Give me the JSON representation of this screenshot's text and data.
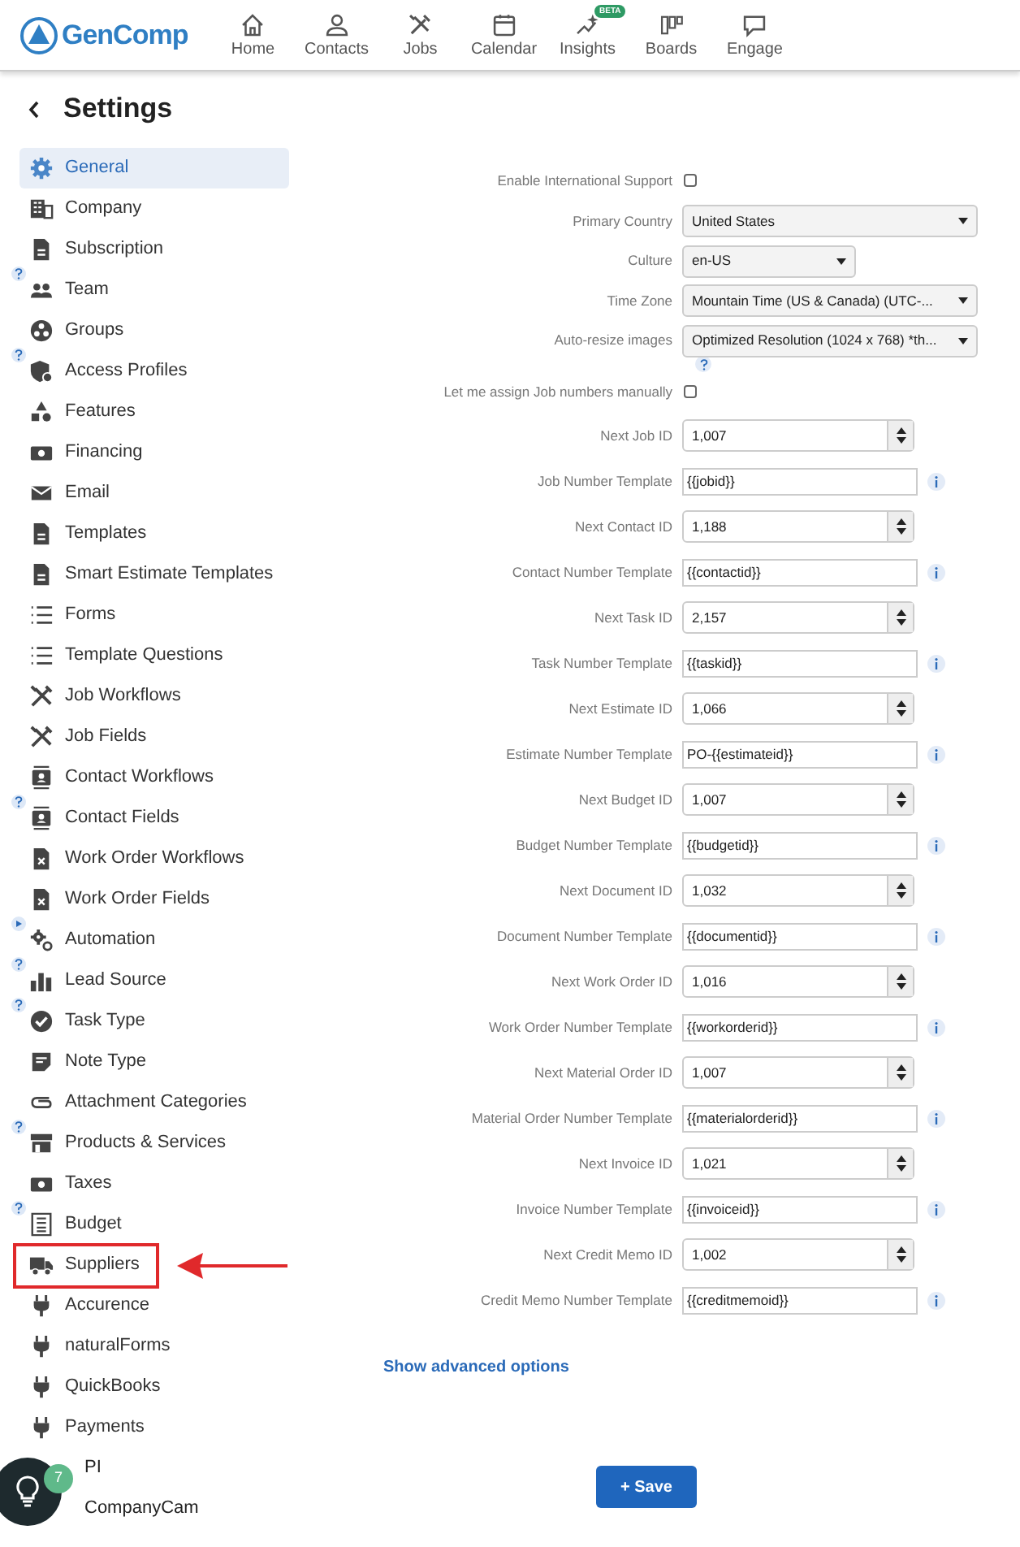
{
  "header": {
    "logo": "GenComp",
    "nav": [
      {
        "label": "Home"
      },
      {
        "label": "Contacts"
      },
      {
        "label": "Jobs"
      },
      {
        "label": "Calendar"
      },
      {
        "label": "Insights",
        "badge": "BETA"
      },
      {
        "label": "Boards"
      },
      {
        "label": "Engage"
      }
    ]
  },
  "page_title": "Settings",
  "sidebar": {
    "items": [
      {
        "label": "General",
        "selected": true,
        "help": false,
        "play": false,
        "highlighted": false
      },
      {
        "label": "Company",
        "selected": false,
        "help": false,
        "play": false,
        "highlighted": false
      },
      {
        "label": "Subscription",
        "selected": false,
        "help": false,
        "play": false,
        "highlighted": false
      },
      {
        "label": "Team",
        "selected": false,
        "help": true,
        "play": false,
        "highlighted": false
      },
      {
        "label": "Groups",
        "selected": false,
        "help": false,
        "play": false,
        "highlighted": false
      },
      {
        "label": "Access Profiles",
        "selected": false,
        "help": true,
        "play": false,
        "highlighted": false
      },
      {
        "label": "Features",
        "selected": false,
        "help": false,
        "play": false,
        "highlighted": false
      },
      {
        "label": "Financing",
        "selected": false,
        "help": false,
        "play": false,
        "highlighted": false
      },
      {
        "label": "Email",
        "selected": false,
        "help": false,
        "play": false,
        "highlighted": false
      },
      {
        "label": "Templates",
        "selected": false,
        "help": false,
        "play": false,
        "highlighted": false
      },
      {
        "label": "Smart Estimate Templates",
        "selected": false,
        "help": false,
        "play": false,
        "highlighted": false
      },
      {
        "label": "Forms",
        "selected": false,
        "help": false,
        "play": false,
        "highlighted": false
      },
      {
        "label": "Template Questions",
        "selected": false,
        "help": false,
        "play": false,
        "highlighted": false
      },
      {
        "label": "Job Workflows",
        "selected": false,
        "help": false,
        "play": false,
        "highlighted": false
      },
      {
        "label": "Job Fields",
        "selected": false,
        "help": false,
        "play": false,
        "highlighted": false
      },
      {
        "label": "Contact Workflows",
        "selected": false,
        "help": false,
        "play": false,
        "highlighted": false
      },
      {
        "label": "Contact Fields",
        "selected": false,
        "help": true,
        "play": false,
        "highlighted": false
      },
      {
        "label": "Work Order Workflows",
        "selected": false,
        "help": false,
        "play": false,
        "highlighted": false
      },
      {
        "label": "Work Order Fields",
        "selected": false,
        "help": false,
        "play": false,
        "highlighted": false
      },
      {
        "label": "Automation",
        "selected": false,
        "help": false,
        "play": true,
        "highlighted": false
      },
      {
        "label": "Lead Source",
        "selected": false,
        "help": true,
        "play": false,
        "highlighted": false
      },
      {
        "label": "Task Type",
        "selected": false,
        "help": true,
        "play": false,
        "highlighted": false
      },
      {
        "label": "Note Type",
        "selected": false,
        "help": false,
        "play": false,
        "highlighted": false
      },
      {
        "label": "Attachment Categories",
        "selected": false,
        "help": false,
        "play": false,
        "highlighted": false
      },
      {
        "label": "Products & Services",
        "selected": false,
        "help": true,
        "play": false,
        "highlighted": false
      },
      {
        "label": "Taxes",
        "selected": false,
        "help": false,
        "play": false,
        "highlighted": false
      },
      {
        "label": "Budget",
        "selected": false,
        "help": true,
        "play": false,
        "highlighted": false
      },
      {
        "label": "Suppliers",
        "selected": false,
        "help": false,
        "play": false,
        "highlighted": true
      },
      {
        "label": "Accurence",
        "selected": false,
        "help": false,
        "play": false,
        "highlighted": false
      },
      {
        "label": "naturalForms",
        "selected": false,
        "help": false,
        "play": false,
        "highlighted": false
      },
      {
        "label": "QuickBooks",
        "selected": false,
        "help": false,
        "play": false,
        "highlighted": false
      },
      {
        "label": "Payments",
        "selected": false,
        "help": false,
        "play": false,
        "highlighted": false
      },
      {
        "label": "PI",
        "selected": false,
        "help": false,
        "play": false,
        "highlighted": false
      },
      {
        "label": "CompanyCam",
        "selected": false,
        "help": false,
        "play": false,
        "highlighted": false
      }
    ]
  },
  "help_button": {
    "count": "7"
  },
  "form": {
    "fields": [
      {
        "kind": "checkbox",
        "label": "Enable International Support",
        "checked": false,
        "help": false
      },
      {
        "kind": "select",
        "label": "Primary Country",
        "value": "United States",
        "help": false
      },
      {
        "kind": "select",
        "label": "Culture",
        "value": "en-US",
        "help": false
      },
      {
        "kind": "select",
        "label": "Time Zone",
        "value": "Mountain Time (US & Canada) (UTC-...",
        "help": false
      },
      {
        "kind": "select",
        "label": "Auto-resize images",
        "value": "Optimized Resolution (1024 x 768) *th...",
        "help": true
      },
      {
        "kind": "checkbox",
        "label": "Let me assign Job numbers manually",
        "checked": false,
        "help": false
      },
      {
        "kind": "number",
        "label": "Next Job ID",
        "value": "1,007",
        "help": false
      },
      {
        "kind": "text",
        "label": "Job Number Template",
        "value": "{{jobid}}",
        "help": false
      },
      {
        "kind": "number",
        "label": "Next Contact ID",
        "value": "1,188",
        "help": false
      },
      {
        "kind": "text",
        "label": "Contact Number Template",
        "value": "{{contactid}}",
        "help": false
      },
      {
        "kind": "number",
        "label": "Next Task ID",
        "value": "2,157",
        "help": false
      },
      {
        "kind": "text",
        "label": "Task Number Template",
        "value": "{{taskid}}",
        "help": false
      },
      {
        "kind": "number",
        "label": "Next Estimate ID",
        "value": "1,066",
        "help": false
      },
      {
        "kind": "text",
        "label": "Estimate Number Template",
        "value": "PO-{{estimateid}}",
        "help": false
      },
      {
        "kind": "number",
        "label": "Next Budget ID",
        "value": "1,007",
        "help": false
      },
      {
        "kind": "text",
        "label": "Budget Number Template",
        "value": "{{budgetid}}",
        "help": false
      },
      {
        "kind": "number",
        "label": "Next Document ID",
        "value": "1,032",
        "help": false
      },
      {
        "kind": "text",
        "label": "Document Number Template",
        "value": "{{documentid}}",
        "help": false
      },
      {
        "kind": "number",
        "label": "Next Work Order ID",
        "value": "1,016",
        "help": false
      },
      {
        "kind": "text",
        "label": "Work Order Number Template",
        "value": "{{workorderid}}",
        "help": false
      },
      {
        "kind": "number",
        "label": "Next Material Order ID",
        "value": "1,007",
        "help": false
      },
      {
        "kind": "text",
        "label": "Material Order Number Template",
        "value": "{{materialorderid}}",
        "help": false
      },
      {
        "kind": "number",
        "label": "Next Invoice ID",
        "value": "1,021",
        "help": false
      },
      {
        "kind": "text",
        "label": "Invoice Number Template",
        "value": "{{invoiceid}}",
        "help": false
      },
      {
        "kind": "number",
        "label": "Next Credit Memo ID",
        "value": "1,002",
        "help": false
      },
      {
        "kind": "text",
        "label": "Credit Memo Number Template",
        "value": "{{creditmemoid}}",
        "help": false
      }
    ],
    "advanced_link": "Show advanced options",
    "save_button": "+ Save"
  }
}
